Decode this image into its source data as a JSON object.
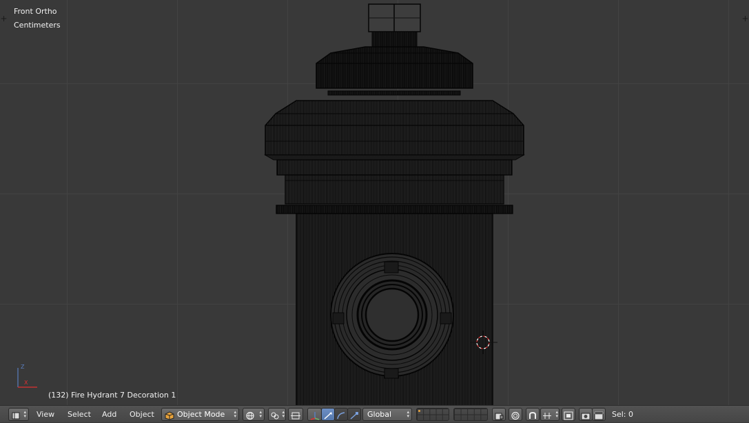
{
  "viewport": {
    "view_name": "Front Ortho",
    "units": "Centimeters",
    "object_info": "(132) Fire Hydrant 7 Decoration 1",
    "axis_labels": {
      "z": "Z",
      "x": "X"
    }
  },
  "header": {
    "menus": {
      "view": "View",
      "select": "Select",
      "add": "Add",
      "object": "Object"
    },
    "mode": {
      "selected": "Object Mode"
    },
    "orientation": {
      "selected": "Global"
    },
    "status": "Sel: 0"
  },
  "colors": {
    "grid": "#434343",
    "background": "#393939",
    "wire": "#0a0a0a",
    "accent_blue": "#5a7fbf",
    "cursor_red": "#e03030"
  },
  "icons": [
    "editor-type-icon",
    "object-mode-cube-icon",
    "viewport-shading-icon",
    "pivot-point-icon",
    "manipulator-icon",
    "translate-icon",
    "rotate-icon",
    "scale-icon",
    "layers-icon",
    "snap-icon",
    "proportional-edit-icon",
    "render-icon",
    "camera-icon",
    "clapper-icon",
    "3d-cursor-icon"
  ]
}
